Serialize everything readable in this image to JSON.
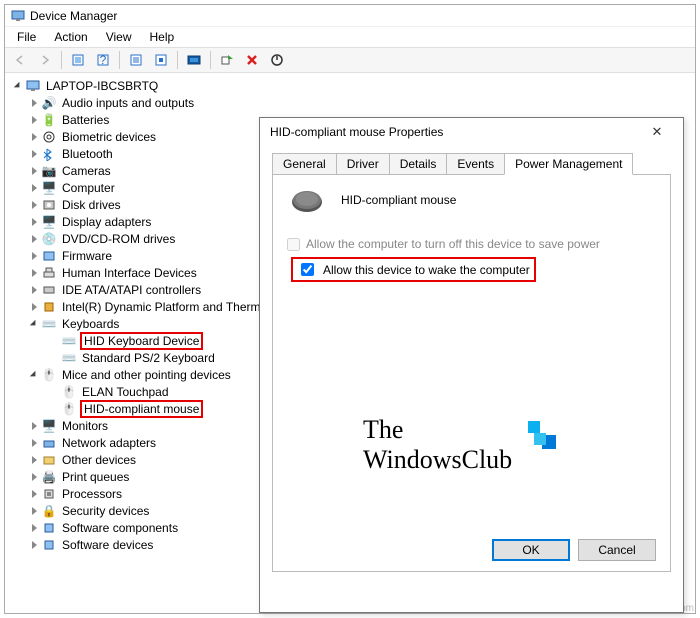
{
  "window": {
    "title": "Device Manager"
  },
  "menu": {
    "file": "File",
    "action": "Action",
    "view": "View",
    "help": "Help"
  },
  "tree": {
    "root": "LAPTOP-IBCSBRTQ",
    "items": [
      "Audio inputs and outputs",
      "Batteries",
      "Biometric devices",
      "Bluetooth",
      "Cameras",
      "Computer",
      "Disk drives",
      "Display adapters",
      "DVD/CD-ROM drives",
      "Firmware",
      "Human Interface Devices",
      "IDE ATA/ATAPI controllers",
      "Intel(R) Dynamic Platform and Thermal",
      "Keyboards",
      "Mice and other pointing devices",
      "Monitors",
      "Network adapters",
      "Other devices",
      "Print queues",
      "Processors",
      "Security devices",
      "Software components",
      "Software devices"
    ],
    "kb1": "HID Keyboard Device",
    "kb2": "Standard PS/2 Keyboard",
    "m1": "ELAN Touchpad",
    "m2": "HID-compliant mouse"
  },
  "dialog": {
    "title": "HID-compliant mouse Properties",
    "tabs": [
      "General",
      "Driver",
      "Details",
      "Events",
      "Power Management"
    ],
    "device": "HID-compliant mouse",
    "opt1": "Allow the computer to turn off this device to save power",
    "opt2": "Allow this device to wake the computer",
    "ok": "OK",
    "cancel": "Cancel"
  },
  "brand": {
    "l1": "The",
    "l2": "WindowsClub"
  },
  "watermark": "wsxdn.com"
}
